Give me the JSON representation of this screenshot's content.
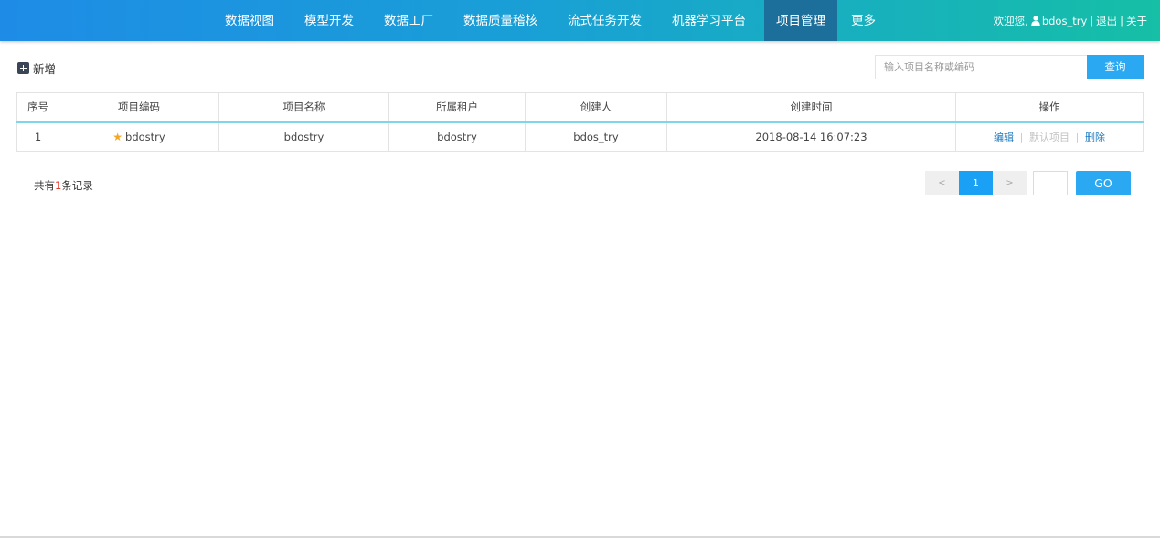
{
  "nav": {
    "items": [
      {
        "label": "数据视图"
      },
      {
        "label": "模型开发"
      },
      {
        "label": "数据工厂"
      },
      {
        "label": "数据质量稽核"
      },
      {
        "label": "流式任务开发"
      },
      {
        "label": "机器学习平台"
      },
      {
        "label": "项目管理",
        "active": true
      },
      {
        "label": "更多"
      }
    ]
  },
  "user": {
    "welcome": "欢迎您,",
    "name": "bdos_try",
    "separator": "|",
    "logout": "退出",
    "about": "关于",
    "icon": "user-icon"
  },
  "toolbar": {
    "add_label": "新增",
    "add_icon": "plus-square-icon",
    "search_placeholder": "输入项目名称或编码",
    "search_value": "",
    "search_button": "查询"
  },
  "table": {
    "headers": [
      "序号",
      "项目编码",
      "项目名称",
      "所属租户",
      "创建人",
      "创建时间",
      "操作"
    ],
    "rows": [
      {
        "index": "1",
        "code": "bdostry",
        "starred": true,
        "name": "bdostry",
        "tenant": "bdostry",
        "creator": "bdos_try",
        "created_at": "2018-08-14 16:07:23",
        "actions": {
          "edit": "编辑",
          "default": "默认项目",
          "delete": "删除",
          "separator": "|"
        }
      }
    ]
  },
  "footer": {
    "total_prefix": "共有",
    "total_count": "1",
    "total_suffix": "条记录",
    "prev": "<",
    "current_page": "1",
    "next": ">",
    "page_input_value": "",
    "go_label": "GO"
  },
  "colors": {
    "accent": "#2aa9f2",
    "nav_gradient_start": "#1e8ce6",
    "nav_gradient_end": "#16bfa6",
    "nav_active": "#1c6f9b",
    "star": "#f5a623",
    "link": "#1f7bc0",
    "count": "#e2372b"
  }
}
